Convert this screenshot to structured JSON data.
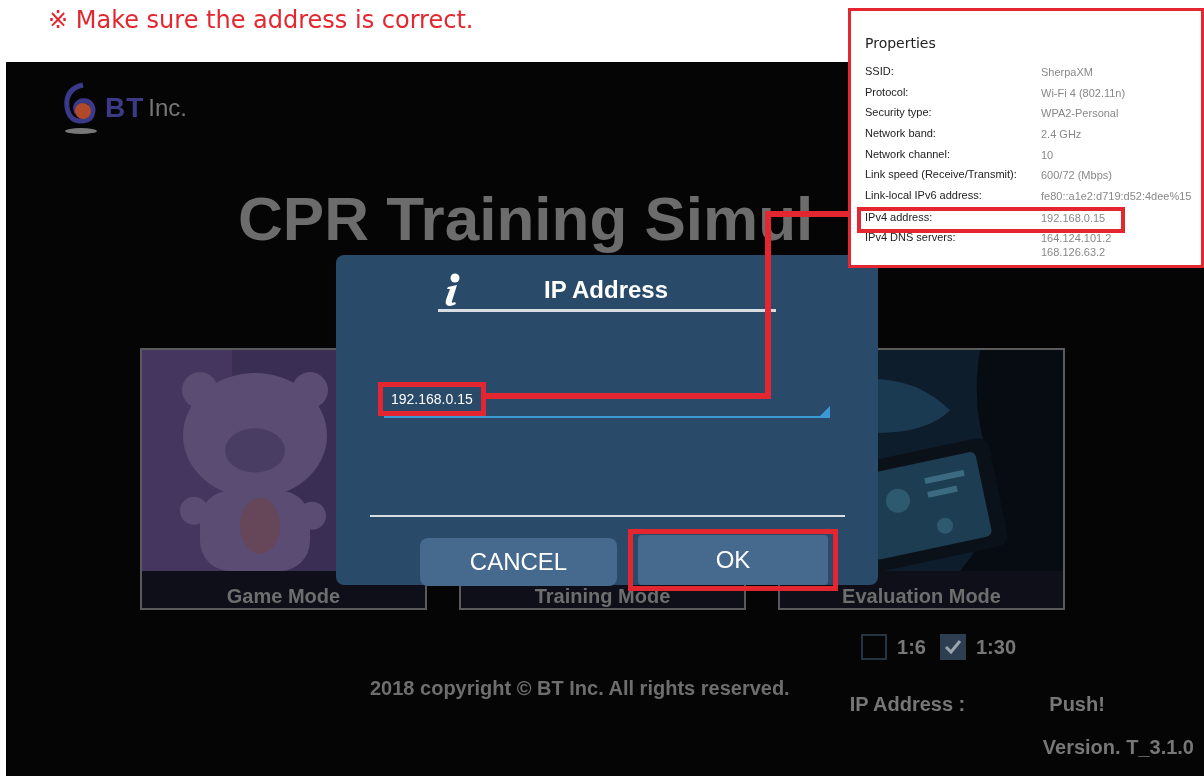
{
  "note": "※ Make sure the address is correct.",
  "app": {
    "logo": {
      "name": "BT",
      "suffix": "Inc."
    },
    "title": "CPR Training Simul",
    "modes": [
      {
        "label": "Game Mode",
        "kind": "game"
      },
      {
        "label": "Training Mode",
        "kind": "training"
      },
      {
        "label": "Evaluation Mode",
        "kind": "evaluation"
      }
    ],
    "ratios": [
      {
        "label": "1:6",
        "checked": false
      },
      {
        "label": "1:30",
        "checked": true
      }
    ],
    "copyright": "2018 copyright © BT Inc. All rights reserved.",
    "ip_label": "IP Address :",
    "push_button": "Push!",
    "version": "Version. T_3.1.0"
  },
  "dialog": {
    "title": "IP Address",
    "value": "192.168.0.15",
    "value_highlighted": true,
    "buttons": [
      {
        "label": "CANCEL",
        "highlighted": false
      },
      {
        "label": "OK",
        "highlighted": true
      }
    ]
  },
  "properties": {
    "title": "Properties",
    "rows": [
      {
        "label": "SSID:",
        "values": [
          "SherpaXM"
        ],
        "highlighted": false
      },
      {
        "label": "Protocol:",
        "values": [
          "Wi-Fi 4 (802.11n)"
        ],
        "highlighted": false
      },
      {
        "label": "Security type:",
        "values": [
          "WPA2-Personal"
        ],
        "highlighted": false
      },
      {
        "label": "Network band:",
        "values": [
          "2.4 GHz"
        ],
        "highlighted": false
      },
      {
        "label": "Network channel:",
        "values": [
          "10"
        ],
        "highlighted": false
      },
      {
        "label": "Link speed (Receive/Transmit):",
        "values": [
          "600/72 (Mbps)"
        ],
        "highlighted": false
      },
      {
        "label": "Link-local IPv6 address:",
        "values": [
          "fe80::a1e2:d719:d52:4dee%15"
        ],
        "highlighted": false
      },
      {
        "label": "IPv4 address:",
        "values": [
          "192.168.0.15"
        ],
        "highlighted": true
      },
      {
        "label": "IPv4 DNS servers:",
        "values": [
          "164.124.101.2",
          "168.126.63.2"
        ],
        "highlighted": false
      }
    ]
  },
  "annotation": {
    "connector": true
  }
}
